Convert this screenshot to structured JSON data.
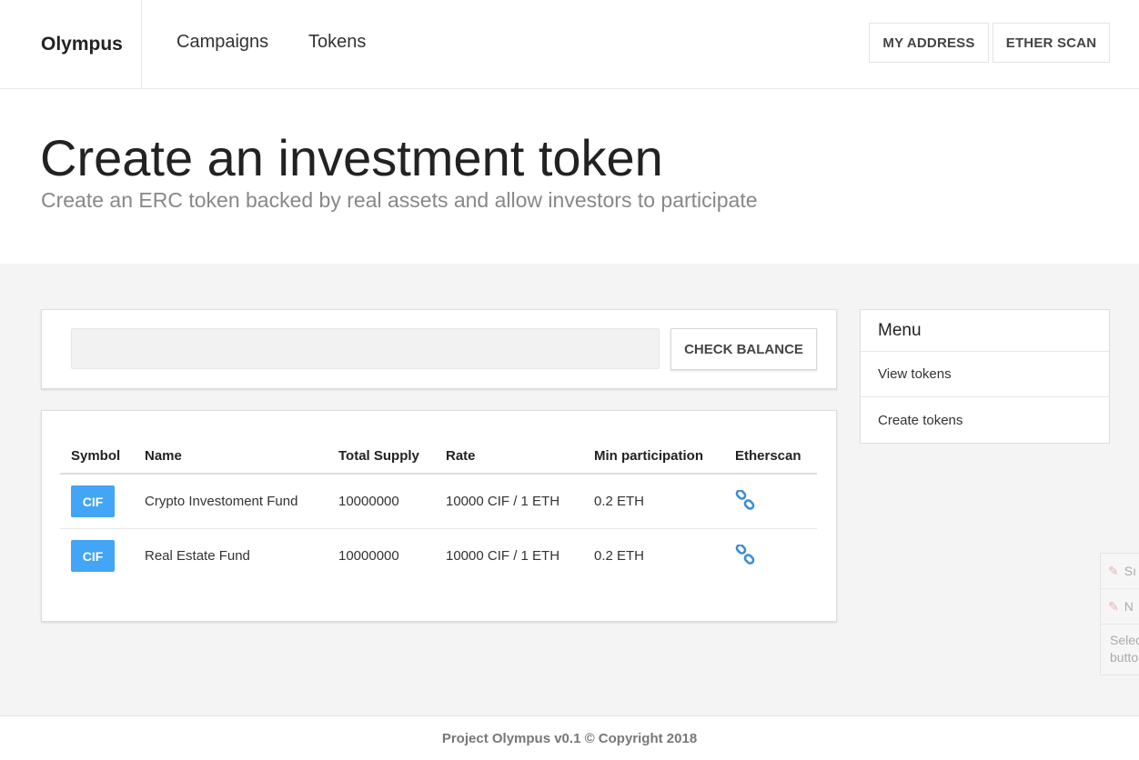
{
  "navbar": {
    "brand": "Olympus",
    "links": [
      "Campaigns",
      "Tokens"
    ],
    "buttons": [
      "MY ADDRESS",
      "ETHER SCAN"
    ]
  },
  "hero": {
    "title": "Create an investment token",
    "subtitle": "Create an ERC token backed by real assets and allow investors to participate"
  },
  "balance": {
    "input_value": "",
    "button_label": "CHECK BALANCE"
  },
  "tokens_table": {
    "headers": [
      "Symbol",
      "Name",
      "Total Supply",
      "Rate",
      "Min participation",
      "Etherscan"
    ],
    "rows": [
      {
        "symbol": "CIF",
        "name": "Crypto Investoment Fund",
        "total_supply": "10000000",
        "rate": "10000 CIF / 1 ETH",
        "min_participation": "0.2 ETH",
        "etherscan_icon": "link-icon"
      },
      {
        "symbol": "CIF",
        "name": "Real Estate Fund",
        "total_supply": "10000000",
        "rate": "10000 CIF / 1 ETH",
        "min_participation": "0.2 ETH",
        "etherscan_icon": "link-icon"
      }
    ]
  },
  "menu": {
    "title": "Menu",
    "items": [
      "View tokens",
      "Create tokens"
    ]
  },
  "stray_popup": {
    "rows": [
      "Sı",
      "N"
    ],
    "text": [
      "Selec",
      "butto"
    ]
  },
  "footer": {
    "text": "Project Olympus v0.1 © Copyright 2018"
  },
  "colors": {
    "badge": "#42a5f5",
    "link_icon": "#3d8fd6",
    "page_bg": "#f4f4f4"
  }
}
